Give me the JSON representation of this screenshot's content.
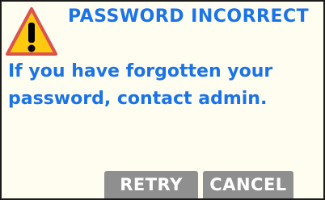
{
  "dialog": {
    "title": "PASSWORD INCORRECT",
    "message_lines": [
      "If you have forgotten your",
      "password, contact admin."
    ],
    "icon": "warning-icon",
    "buttons": {
      "retry_label": "RETRY",
      "cancel_label": "CANCEL"
    }
  },
  "colors": {
    "text_blue": "#1a73e8",
    "warning_fill": "#ffc90e",
    "warning_border": "#d9534f",
    "button_gray": "#8f8f8f"
  }
}
